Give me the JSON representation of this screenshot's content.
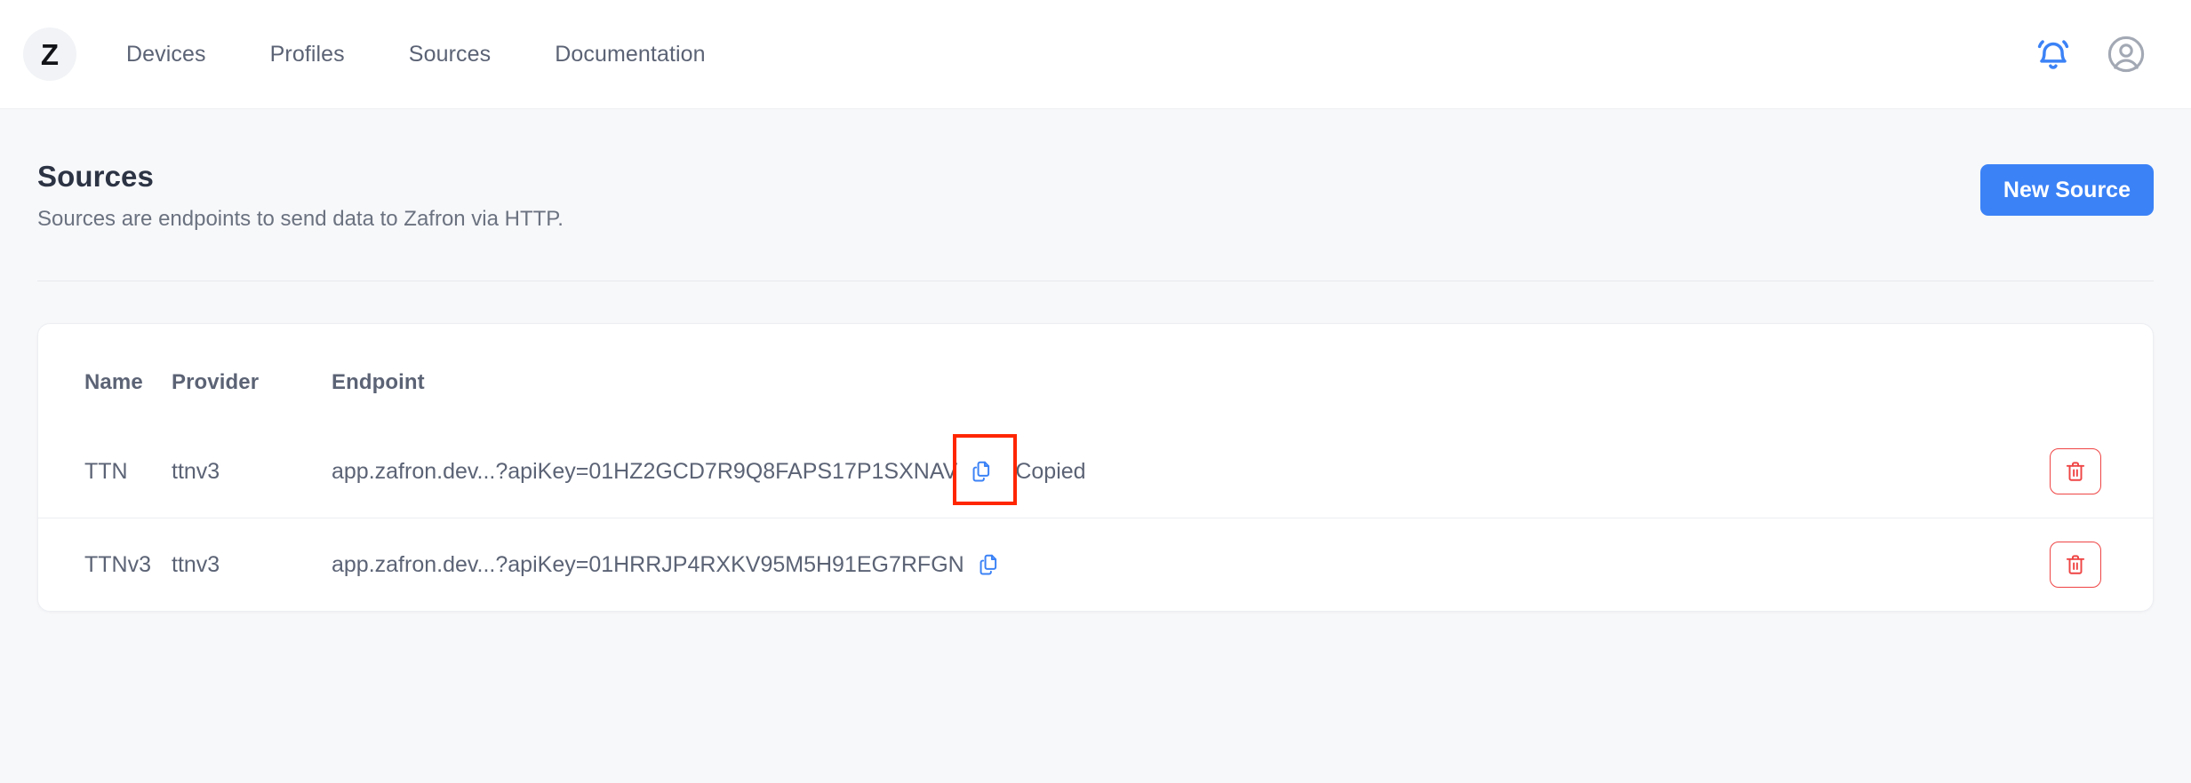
{
  "brand": {
    "letter": "Z",
    "name": "zafron-logo"
  },
  "nav": {
    "items": [
      {
        "label": "Devices"
      },
      {
        "label": "Profiles"
      },
      {
        "label": "Sources"
      },
      {
        "label": "Documentation"
      }
    ],
    "notifications_icon": "bell-icon",
    "account_icon": "user-avatar-icon",
    "notification_color": "#3b82f6",
    "account_color": "#a3a9b4"
  },
  "page": {
    "title": "Sources",
    "subtitle": "Sources are endpoints to send data to Zafron via HTTP.",
    "new_source_label": "New Source",
    "accent_color": "#3b82f6"
  },
  "table": {
    "headers": {
      "name": "Name",
      "provider": "Provider",
      "endpoint": "Endpoint"
    },
    "rows": [
      {
        "name": "TTN",
        "provider": "ttnv3",
        "endpoint": "app.zafron.dev...?apiKey=01HZ2GCD7R9Q8FAPS17P1SXNAV",
        "copy_icon": "copy-icon",
        "copied_label": "Copied",
        "copied_visible": true,
        "highlighted": true,
        "delete_icon": "trash-icon"
      },
      {
        "name": "TTNv3",
        "provider": "ttnv3",
        "endpoint": "app.zafron.dev...?apiKey=01HRRJP4RXKV95M5H91EG7RFGN",
        "copy_icon": "copy-icon",
        "copied_label": "",
        "copied_visible": false,
        "highlighted": false,
        "delete_icon": "trash-icon"
      }
    ],
    "delete_color": "#ef4444",
    "copy_color": "#3b82f6",
    "highlight_color": "#ff2600"
  }
}
